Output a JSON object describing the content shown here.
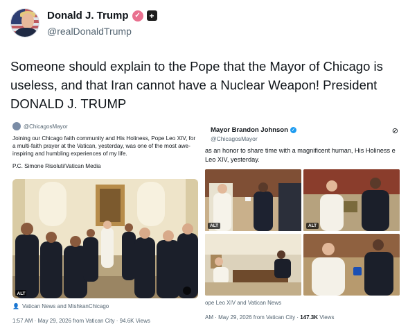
{
  "post": {
    "display_name": "Donald J. Trump",
    "handle": "@realDonaldTrump",
    "text": "Someone should explain to the Pope that the Mayor of Chicago is useless, and that Iran cannot have a Nuclear Weapon! President DONALD J. TRUMP",
    "verified_icon": "verified-badge-icon",
    "affiliation_icon": "affiliation-plus-icon",
    "accent_color": "#e9708f"
  },
  "quote_left": {
    "handle": "@ChicagosMayor",
    "body": "Joining our Chicago faith community and His Holiness, Pope Leo XIV, for a multi-faith prayer at the Vatican, yesterday, was one of the most awe-inspiring and humbling experiences of my life.",
    "credit": "P.C. Simone Risoluti/Vatican Media",
    "photo_alt_badge": "ALT",
    "photo_caption": "Vatican News and MishkanChicago",
    "meta": "1:57 AM · May 29, 2026 from Vatican City · 94.6K Views"
  },
  "quote_right": {
    "display_name": "Mayor Brandon Johnson",
    "handle": "@ChicagosMayor",
    "body": "as an honor to share time with a magnificent human, His Holiness e Leo XIV, yesterday.",
    "alt_badge": "ALT",
    "caption": "ope Leo XIV and Vatican News",
    "meta_prefix": "AM · May 29, 2026 from Vatican City · ",
    "views_count": "147.3K",
    "views_label": " Views"
  }
}
